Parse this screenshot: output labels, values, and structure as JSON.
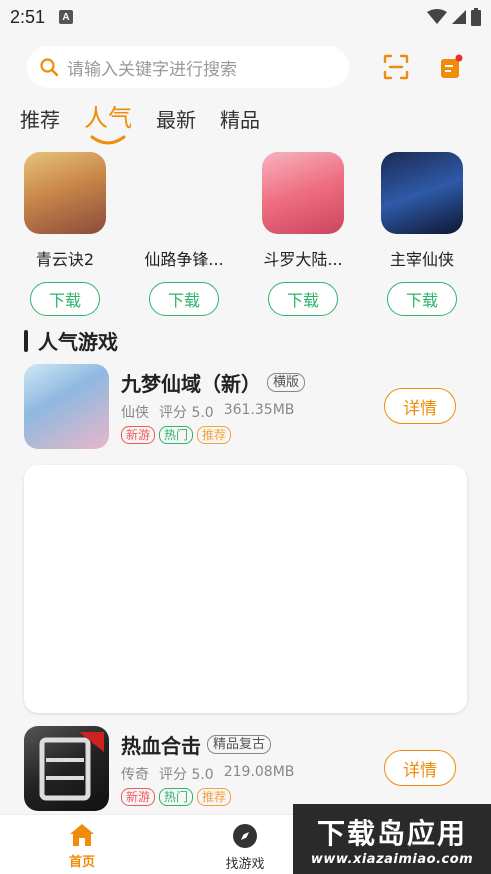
{
  "status_bar": {
    "time": "2:51",
    "badge": "A"
  },
  "search": {
    "placeholder": "请输入关键字进行搜索"
  },
  "tabs": [
    {
      "label": "推荐"
    },
    {
      "label": "人气"
    },
    {
      "label": "最新"
    },
    {
      "label": "精品"
    }
  ],
  "top_apps": [
    {
      "name": "青云诀2",
      "button": "下载"
    },
    {
      "name": "仙路争锋...",
      "button": "下载"
    },
    {
      "name": "斗罗大陆...",
      "button": "下载"
    },
    {
      "name": "主宰仙侠",
      "button": "下载"
    }
  ],
  "section": {
    "title": "人气游戏"
  },
  "games": [
    {
      "name": "九梦仙域（新）",
      "tag": "横版",
      "category": "仙侠",
      "rating": "评分 5.0",
      "size": "361.35MB",
      "labels": [
        "新游",
        "热门",
        "推荐"
      ],
      "button": "详情"
    },
    {
      "name": "热血合击",
      "tag": "精品复古",
      "category": "传奇",
      "rating": "评分 5.0",
      "size": "219.08MB",
      "labels": [
        "新游",
        "热门",
        "推荐"
      ],
      "button": "详情"
    }
  ],
  "bottom_nav": [
    {
      "label": "首页",
      "icon": "home-icon"
    },
    {
      "label": "找游戏",
      "icon": "compass-icon"
    }
  ],
  "watermark": {
    "big": "下载岛应用",
    "small": "www.xiazaimiao.com"
  },
  "colors": {
    "accent": "#f08c0a",
    "green": "#2fb36a",
    "red": "#ef5b5b"
  }
}
